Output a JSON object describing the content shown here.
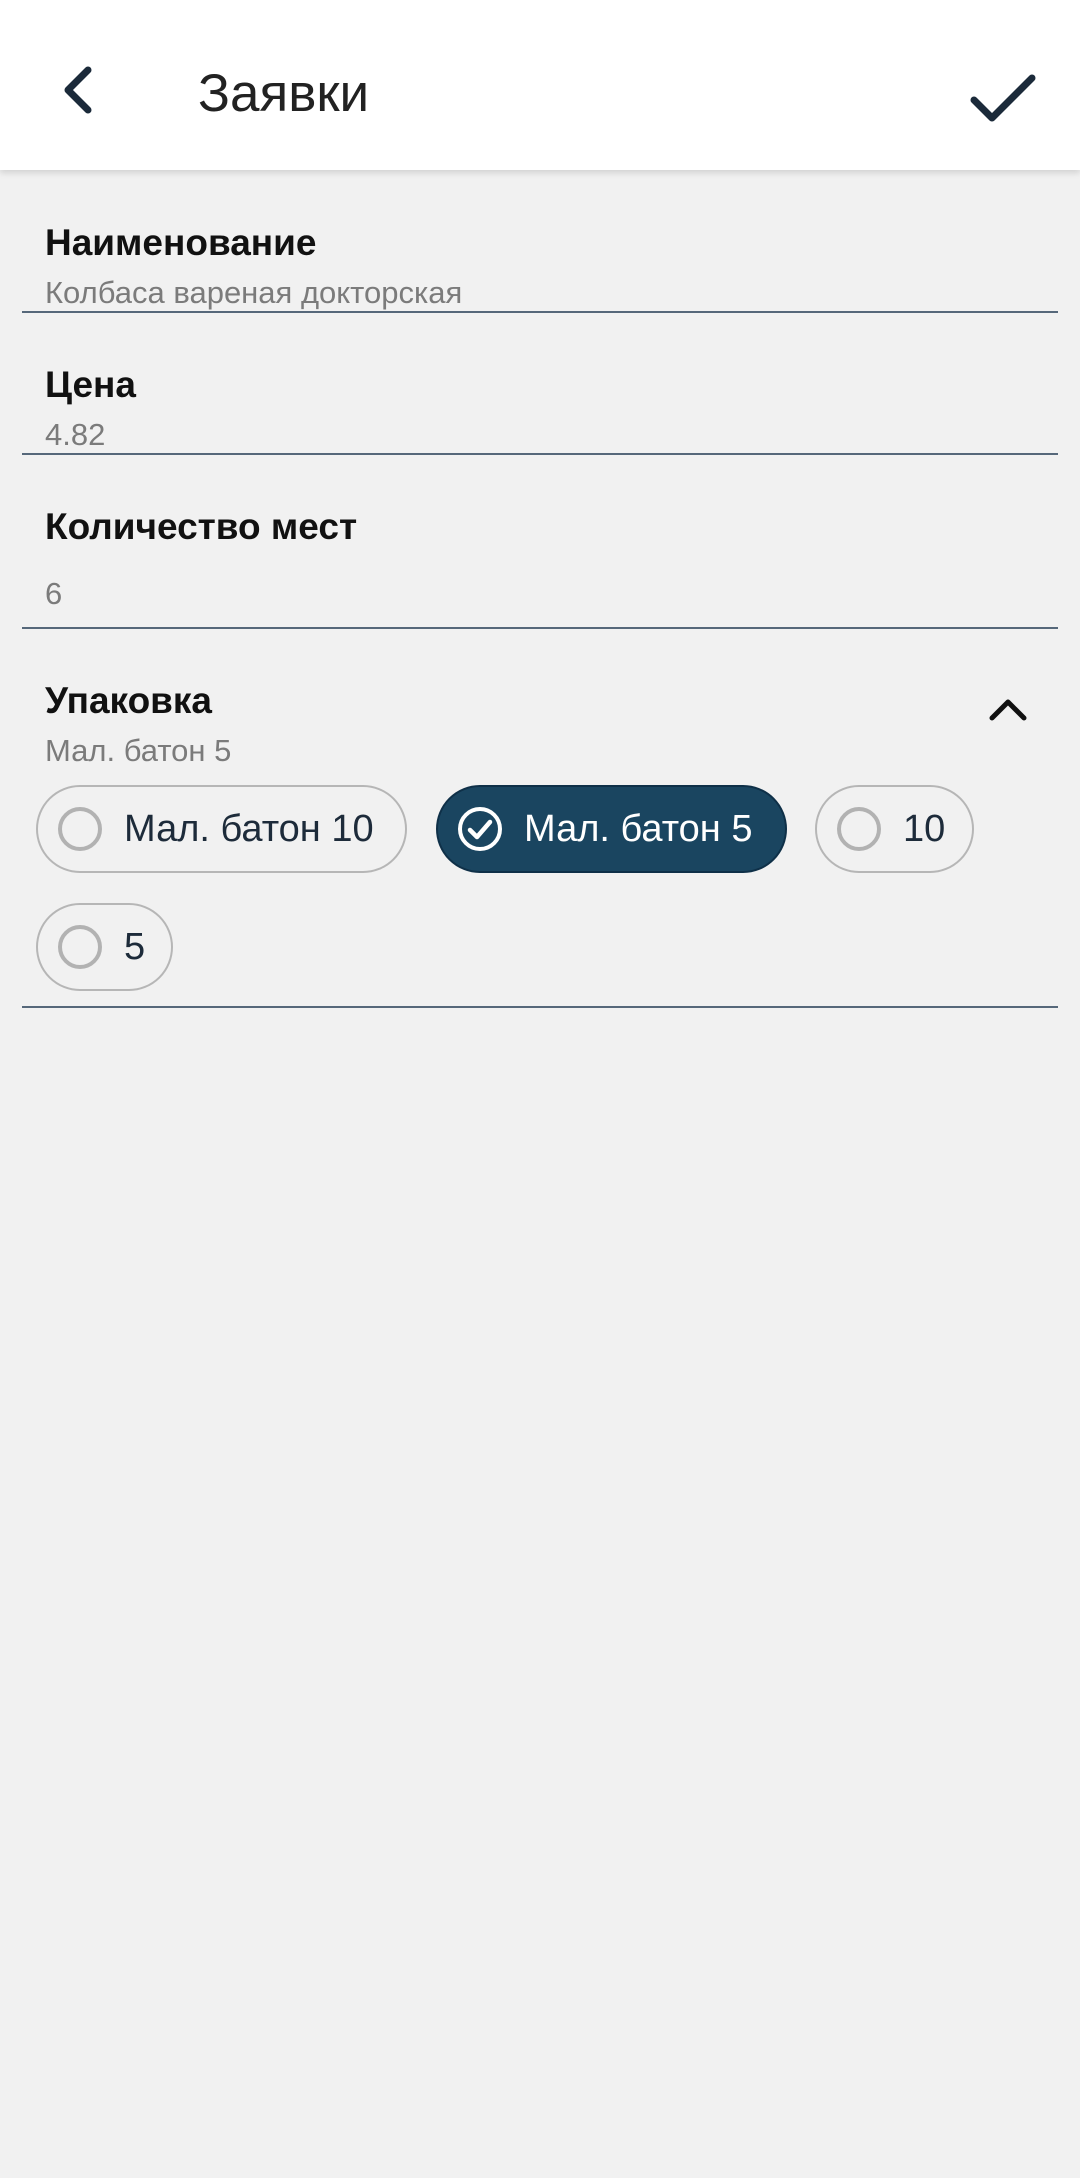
{
  "appbar": {
    "title": "Заявки",
    "back_icon": "chevron-left-icon",
    "confirm_icon": "checkmark-icon"
  },
  "fields": {
    "name": {
      "label": "Наименование",
      "value": "Колбаса вареная докторская"
    },
    "price": {
      "label": "Цена",
      "value": "4.82"
    },
    "quantity": {
      "label": "Количество мест",
      "value": "6"
    },
    "packaging": {
      "label": "Упаковка",
      "value": "Мал. батон 5",
      "expanded_icon": "chevron-up-icon",
      "options": [
        {
          "label": "Мал. батон 10",
          "selected": false
        },
        {
          "label": "Мал. батон 5",
          "selected": true
        },
        {
          "label": "10",
          "selected": false
        },
        {
          "label": "5",
          "selected": false
        }
      ]
    }
  },
  "colors": {
    "accent": "#1a4560",
    "divider": "#56687a",
    "background": "#f1f1f1",
    "appbar": "#ffffff",
    "icon": "#1b2a3a"
  }
}
